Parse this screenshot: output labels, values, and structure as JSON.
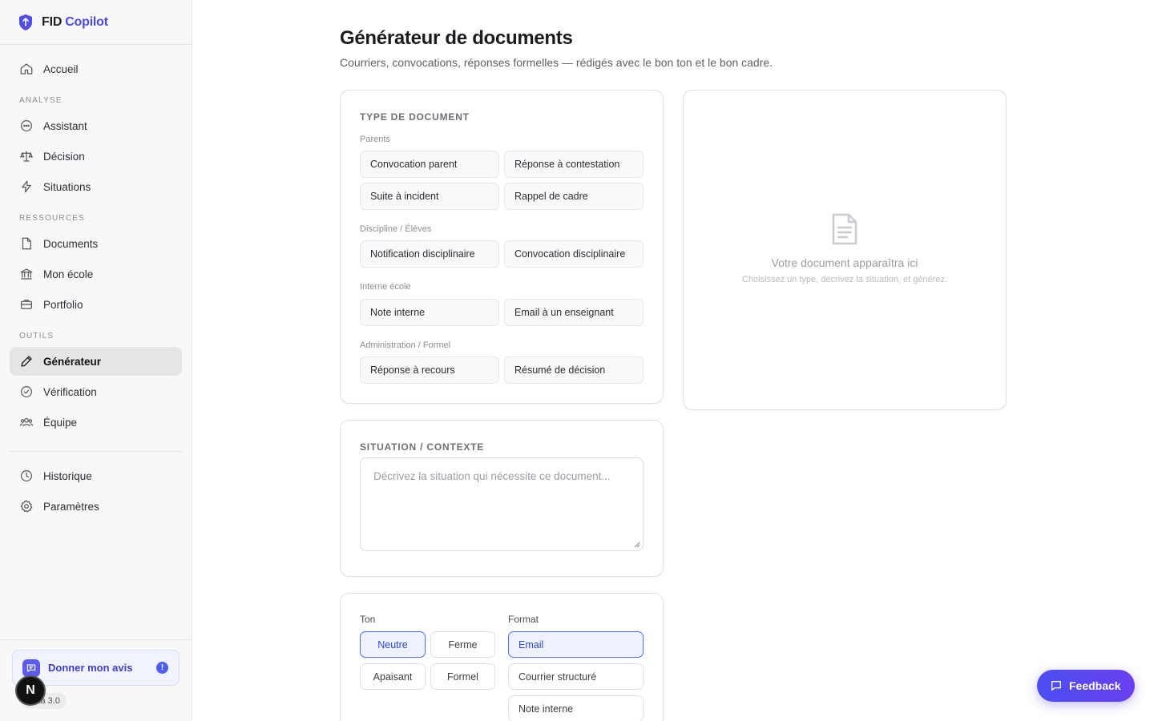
{
  "brand": {
    "part1": "FID",
    "part2": "Copilot"
  },
  "nav": {
    "home": "Accueil",
    "section_analyse": "ANALYSE",
    "assistant": "Assistant",
    "decision": "Décision",
    "situations": "Situations",
    "section_ressources": "RESSOURCES",
    "documents": "Documents",
    "mon_ecole": "Mon école",
    "portfolio": "Portfolio",
    "section_outils": "OUTILS",
    "generateur": "Générateur",
    "verification": "Vérification",
    "equipe": "Équipe",
    "historique": "Historique",
    "parametres": "Paramètres"
  },
  "sidebar_bottom": {
    "feedback_label": "Donner mon avis",
    "feedback_badge": "!",
    "version": "Beta 3.0",
    "avatar_letter": "N"
  },
  "page": {
    "title": "Générateur de documents",
    "subtitle": "Courriers, convocations, réponses formelles — rédigés avec le bon ton et le bon cadre."
  },
  "doc_type": {
    "title": "TYPE DE DOCUMENT",
    "groups": [
      {
        "label": "Parents",
        "options": [
          "Convocation parent",
          "Réponse à contestation",
          "Suite à incident",
          "Rappel de cadre"
        ]
      },
      {
        "label": "Discipline / Élèves",
        "options": [
          "Notification disciplinaire",
          "Convocation disciplinaire"
        ]
      },
      {
        "label": "Interne école",
        "options": [
          "Note interne",
          "Email à un enseignant"
        ]
      },
      {
        "label": "Administration / Formel",
        "options": [
          "Réponse à recours",
          "Résumé de décision"
        ]
      }
    ]
  },
  "situation": {
    "title": "SITUATION / CONTEXTE",
    "placeholder": "Décrivez la situation qui nécessite ce document..."
  },
  "tone": {
    "label": "Ton",
    "options": [
      "Neutre",
      "Ferme",
      "Apaisant",
      "Formel"
    ],
    "selected": "Neutre"
  },
  "format": {
    "label": "Format",
    "options": [
      "Email",
      "Courrier structuré",
      "Note interne"
    ],
    "selected": "Email"
  },
  "preview": {
    "empty_title": "Votre document apparaîtra ici",
    "empty_sub": "Choisissez un type, décrivez la situation, et générez."
  },
  "floating": {
    "feedback": "Feedback"
  },
  "colors": {
    "accent": "#4f6ef0",
    "brand": "#4a4ae0",
    "active_nav_bg": "#e5e5e8"
  }
}
